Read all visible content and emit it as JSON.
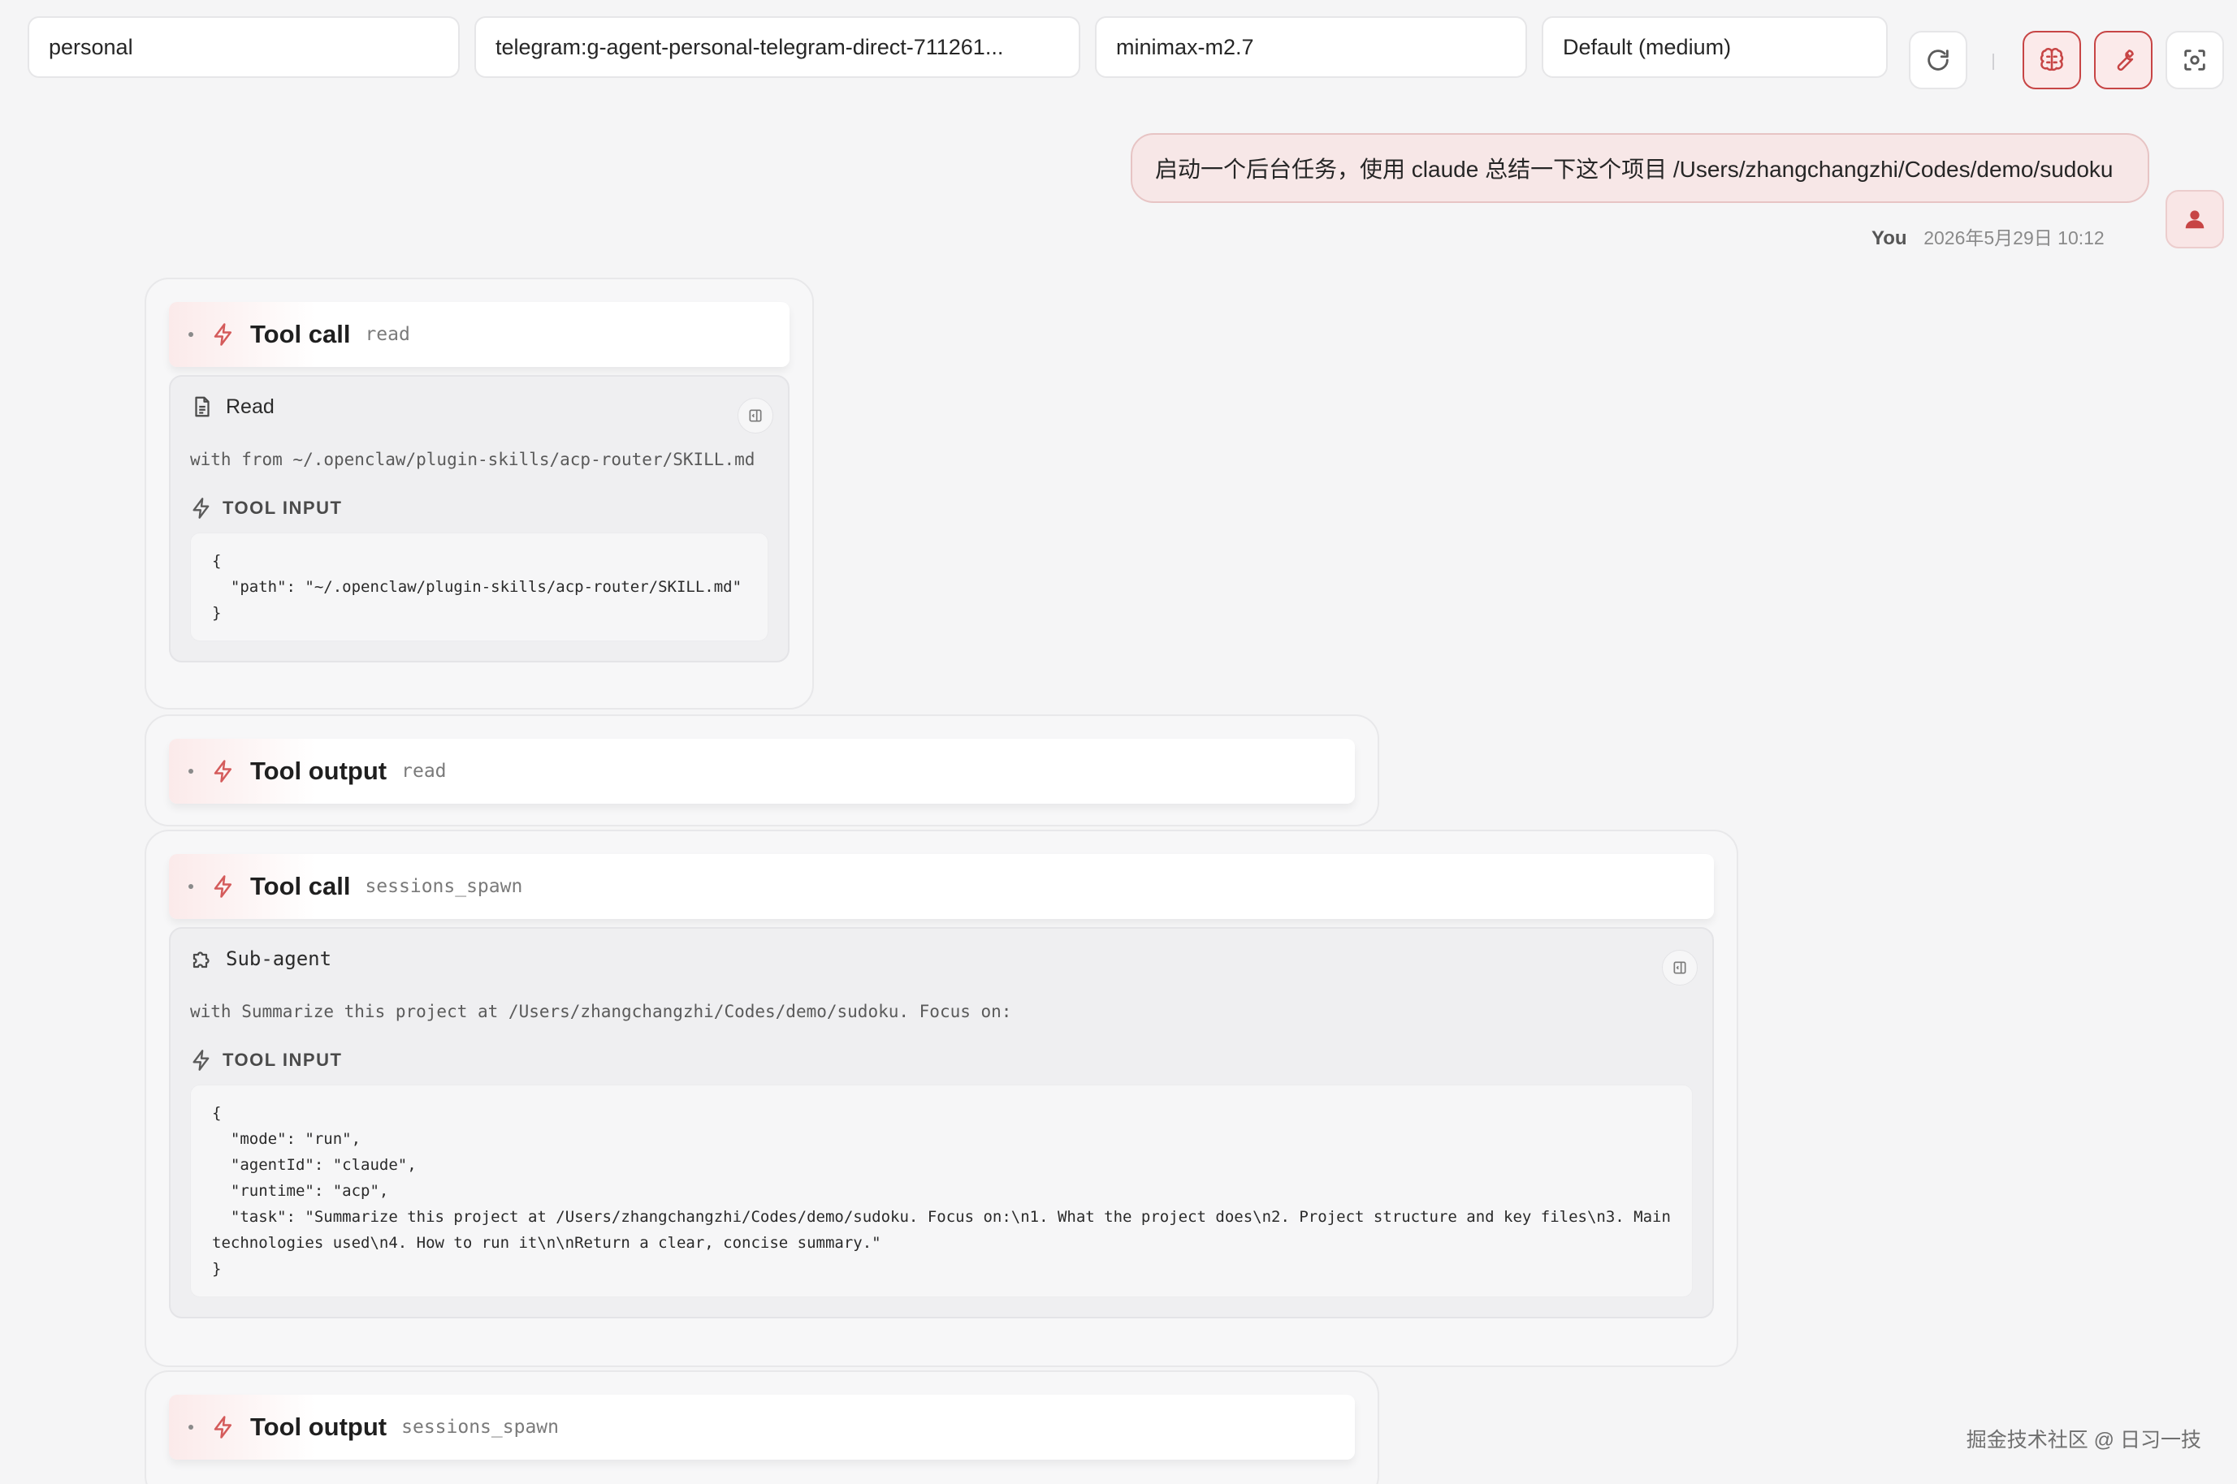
{
  "toolbar": {
    "agent": "personal",
    "session": "telegram:g-agent-personal-telegram-direct-711261...",
    "model": "minimax-m2.7",
    "thinking": "Default (medium)"
  },
  "user_message": {
    "text": "启动一个后台任务，使用 claude 总结一下这个项目 /Users/zhangchangzhi/Codes/demo/sudoku",
    "sender": "You",
    "timestamp": "2026年5月29日 10:12"
  },
  "messages": [
    {
      "title": "Tool call",
      "tool": "read",
      "card_label": "Read",
      "description": "with from ~/.openclaw/plugin-skills/acp-router/SKILL.md",
      "input_label": "TOOL INPUT",
      "input": "{\n  \"path\": \"~/.openclaw/plugin-skills/acp-router/SKILL.md\"\n}"
    },
    {
      "title": "Tool output",
      "tool": "read"
    },
    {
      "title": "Tool call",
      "tool": "sessions_spawn",
      "card_label": "Sub-agent",
      "description": "with Summarize this project at /Users/zhangchangzhi/Codes/demo/sudoku. Focus on:",
      "input_label": "TOOL INPUT",
      "input": "{\n  \"mode\": \"run\",\n  \"agentId\": \"claude\",\n  \"runtime\": \"acp\",\n  \"task\": \"Summarize this project at /Users/zhangchangzhi/Codes/demo/sudoku. Focus on:\\n1. What the project does\\n2. Project structure and key files\\n3. Main technologies used\\n4. How to run it\\n\\nReturn a clear, concise summary.\"\n}"
    },
    {
      "title": "Tool output",
      "tool": "sessions_spawn"
    }
  ],
  "watermark": "掘金技术社区 @ 日习一技",
  "colors": {
    "accent": "#c74545",
    "accent_soft": "#f7e7e7",
    "background": "#f5f5f6"
  },
  "icons": {
    "refresh": "refresh-icon",
    "brain": "brain-icon",
    "wrench": "wrench-icon",
    "focus": "focus-icon",
    "avatar": "user-icon",
    "bolt": "lightning-icon",
    "file": "file-icon",
    "subagent": "puzzle-icon",
    "expand": "sidebar-expand-icon"
  }
}
